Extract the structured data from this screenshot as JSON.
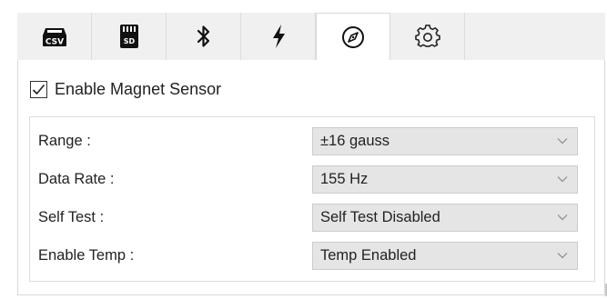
{
  "tabs": [
    {
      "id": "csv",
      "icon": "csv-icon",
      "text": "CSV"
    },
    {
      "id": "sd",
      "icon": "sd-card-icon",
      "text": "SD"
    },
    {
      "id": "bluetooth",
      "icon": "bluetooth-icon"
    },
    {
      "id": "power",
      "icon": "lightning-icon"
    },
    {
      "id": "magnet",
      "icon": "compass-icon",
      "active": true
    },
    {
      "id": "settings",
      "icon": "gear-icon"
    }
  ],
  "magnet": {
    "enable_label": "Enable Magnet Sensor",
    "enable_checked": true,
    "rows": [
      {
        "label": "Range :",
        "value": "±16 gauss"
      },
      {
        "label": "Data Rate :",
        "value": "155 Hz"
      },
      {
        "label": "Self Test :",
        "value": "Self Test Disabled"
      },
      {
        "label": "Enable Temp :",
        "value": "Temp Enabled"
      }
    ]
  },
  "colors": {
    "tab_bg": "#f0f0f0",
    "active_tab_bg": "#ffffff",
    "select_bg": "#e5e5e5",
    "border": "#d9d9d9",
    "text": "#222222"
  }
}
